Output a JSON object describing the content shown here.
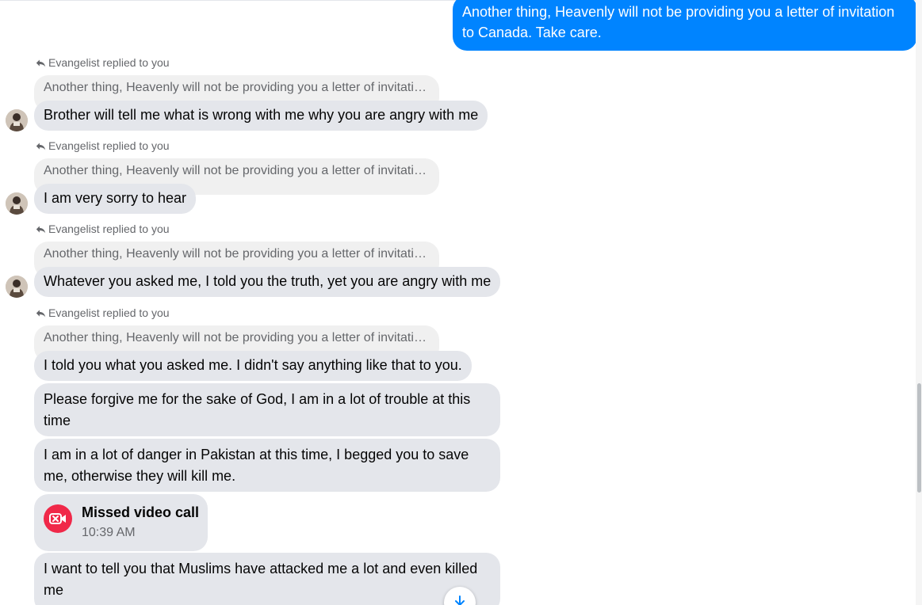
{
  "outgoing": {
    "text": "Another thing, Heavenly will not be providing you a letter of invitation to Canada. Take care."
  },
  "replies": [
    {
      "label": "Evangelist replied to you",
      "quote": "Another thing, Heavenly will not be providing you a letter of invitation to Canada. Take care.",
      "message": "Brother will tell me what is wrong with me why you are angry with me"
    },
    {
      "label": "Evangelist replied to you",
      "quote": "Another thing, Heavenly will not be providing you a letter of invitation to Canada. Take care.",
      "message": "I am very sorry to hear"
    },
    {
      "label": "Evangelist replied to you",
      "quote": "Another thing, Heavenly will not be providing you a letter of invitation to Canada. Take care.",
      "message": "Whatever you asked me, I told you the truth, yet you are angry with me"
    },
    {
      "label": "Evangelist replied to you",
      "quote": "Another thing, Heavenly will not be providing you a letter of invitation to Canada. Take care.",
      "message": "I told you what you asked me. I didn't say anything like that to you."
    }
  ],
  "messages": [
    "Please forgive me for the sake of God, I am in a lot of trouble at this time",
    "I am in a lot of danger in Pakistan at this time, I begged you to save me, otherwise they will kill me."
  ],
  "missed_call": {
    "title": "Missed video call",
    "time": "10:39 AM",
    "icon": "missed-video-call-icon"
  },
  "last_message": "I want to tell you that Muslims have attacked me a lot and even killed me",
  "colors": {
    "outgoing_bubble": "#0084ff",
    "incoming_bubble": "#e4e6eb",
    "missed_call_accent": "#f02849"
  }
}
